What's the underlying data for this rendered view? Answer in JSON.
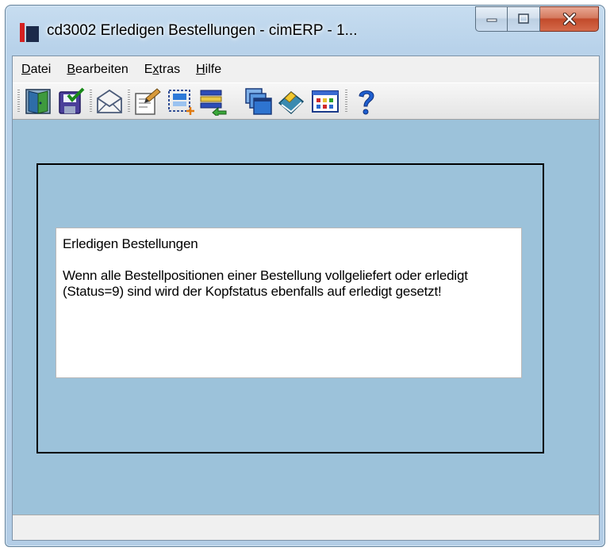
{
  "window": {
    "title": "cd3002 Erledigen Bestellungen - cimERP - 1..."
  },
  "menu": {
    "items": [
      {
        "pre": "",
        "key": "D",
        "post": "atei"
      },
      {
        "pre": "",
        "key": "B",
        "post": "earbeiten"
      },
      {
        "pre": "E",
        "key": "x",
        "post": "tras"
      },
      {
        "pre": "",
        "key": "H",
        "post": "ilfe"
      }
    ]
  },
  "toolbar": {
    "icons": [
      "exit-door-icon",
      "save-icon",
      "mail-icon",
      "edit-icon",
      "new-record-icon",
      "insert-row-icon",
      "windows-icon",
      "book-icon",
      "grid-icon",
      "help-icon"
    ]
  },
  "info": {
    "title": "Erledigen Bestellungen",
    "body": "Wenn alle Bestellpositionen einer Bestellung vollgeliefert oder erledigt (Status=9) sind wird der Kopfstatus ebenfalls auf erledigt gesetzt!"
  },
  "colors": {
    "client_bg": "#9cc2da",
    "window_frame": "#b3cde6",
    "close_button": "#c24a2b"
  }
}
